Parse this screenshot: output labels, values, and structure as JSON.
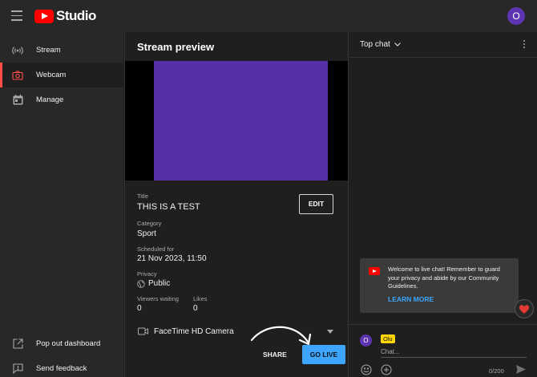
{
  "app": {
    "name": "Studio",
    "account_initial": "O"
  },
  "sidebar": {
    "items": [
      {
        "label": "Stream",
        "icon": "broadcast-icon"
      },
      {
        "label": "Webcam",
        "icon": "camera-icon",
        "active": true
      },
      {
        "label": "Manage",
        "icon": "calendar-icon"
      }
    ],
    "bottom": [
      {
        "label": "Pop out dashboard",
        "icon": "external-link-icon"
      },
      {
        "label": "Send feedback",
        "icon": "feedback-icon"
      }
    ]
  },
  "stream": {
    "panel_title": "Stream preview",
    "title_label": "Title",
    "title_value": "THIS IS A TEST",
    "edit_label": "EDIT",
    "category_label": "Category",
    "category_value": "Sport",
    "scheduled_label": "Scheduled for",
    "scheduled_value": "21 Nov 2023, 11:50",
    "privacy_label": "Privacy",
    "privacy_value": "Public",
    "viewers_label": "Viewers waiting",
    "viewers_value": "0",
    "likes_label": "Likes",
    "likes_value": "0",
    "camera_value": "FaceTime HD Camera",
    "share_label": "SHARE",
    "golive_label": "GO LIVE"
  },
  "chat": {
    "title": "Top chat",
    "welcome_text": "Welcome to live chat! Remember to guard your privacy and abide by our Community Guidelines.",
    "learn_more": "LEARN MORE",
    "user_initial": "O",
    "user_name": "Olu",
    "input_placeholder": "Chat...",
    "char_count": "0/200"
  },
  "colors": {
    "accent_red": "#ff0000",
    "accent_blue": "#3ea6ff",
    "avatar_purple": "#5e35b1",
    "preview_purple": "#5530a8",
    "username_yellow": "#ffd600"
  }
}
